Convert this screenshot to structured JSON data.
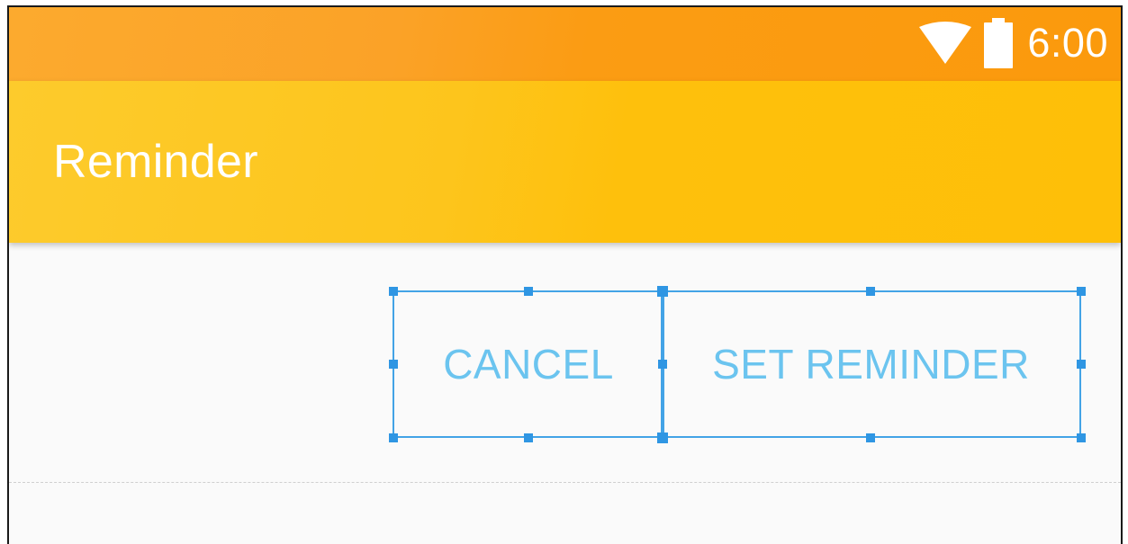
{
  "status_bar": {
    "time": "6:00",
    "icons": [
      "wifi-icon",
      "battery-icon"
    ],
    "color": "#fb9c13"
  },
  "app_bar": {
    "title": "Reminder",
    "color": "#fec00c"
  },
  "buttons": {
    "cancel_label": "CANCEL",
    "set_reminder_label": "SET REMINDER",
    "text_color": "#6bc4ef",
    "selection_color": "#2f96e3"
  }
}
